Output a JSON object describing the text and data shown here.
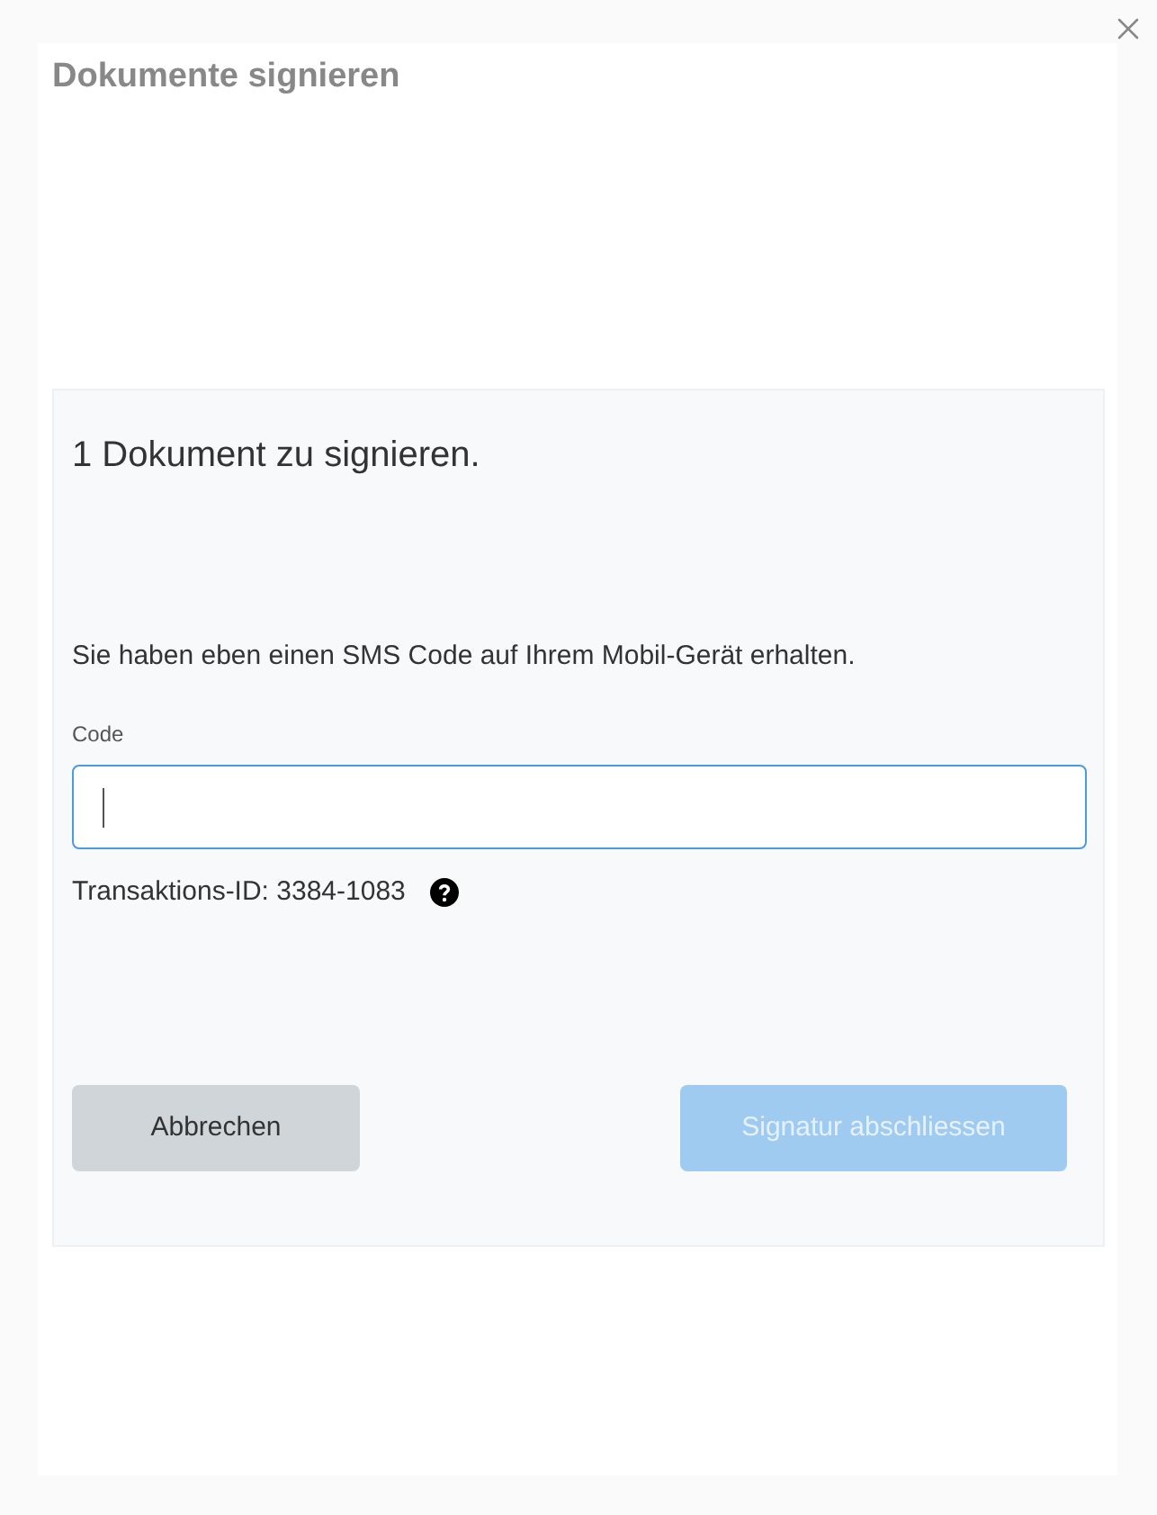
{
  "dialog": {
    "title": "Dokumente signieren"
  },
  "panel": {
    "heading": "1 Dokument zu signieren.",
    "message": "Sie haben eben einen SMS Code auf Ihrem Mobil-Gerät erhalten.",
    "code_field": {
      "label": "Code",
      "focused": true
    },
    "transaction": "Transaktions-ID: 3384-1083",
    "buttons": [
      {
        "label": "Abbrechen",
        "kind": "secondary",
        "disabled": false
      },
      {
        "label": "Signatur abschliessen",
        "kind": "primary",
        "disabled": true
      }
    ]
  }
}
